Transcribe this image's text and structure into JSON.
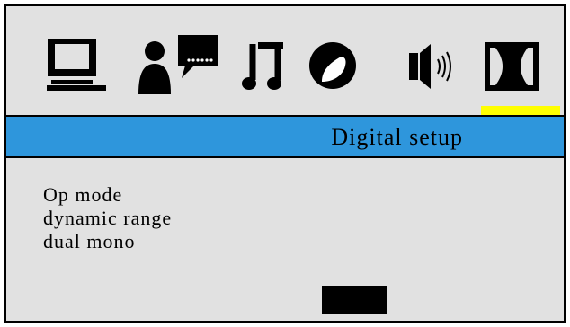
{
  "window": {
    "title": ""
  },
  "setup_tabs": [
    {
      "id": "tv",
      "icon": "tv-display-icon"
    },
    {
      "id": "language",
      "icon": "person-speech-bubble-icon"
    },
    {
      "id": "audio",
      "icon": "music-note-icon"
    },
    {
      "id": "picture",
      "icon": "picture-contrast-icon"
    },
    {
      "id": "speaker",
      "icon": "speaker-icon"
    },
    {
      "id": "digital",
      "icon": "dolby-digital-icon",
      "selected": true
    }
  ],
  "header": {
    "title": "Digital setup"
  },
  "menu": {
    "items": [
      {
        "label": "Op mode"
      },
      {
        "label": "dynamic range"
      },
      {
        "label": "dual mono"
      }
    ]
  },
  "colors": {
    "background": "#e1e1e1",
    "header": "#2e96dc",
    "selection_indicator": "#ffff00",
    "value_box": "#000000"
  }
}
